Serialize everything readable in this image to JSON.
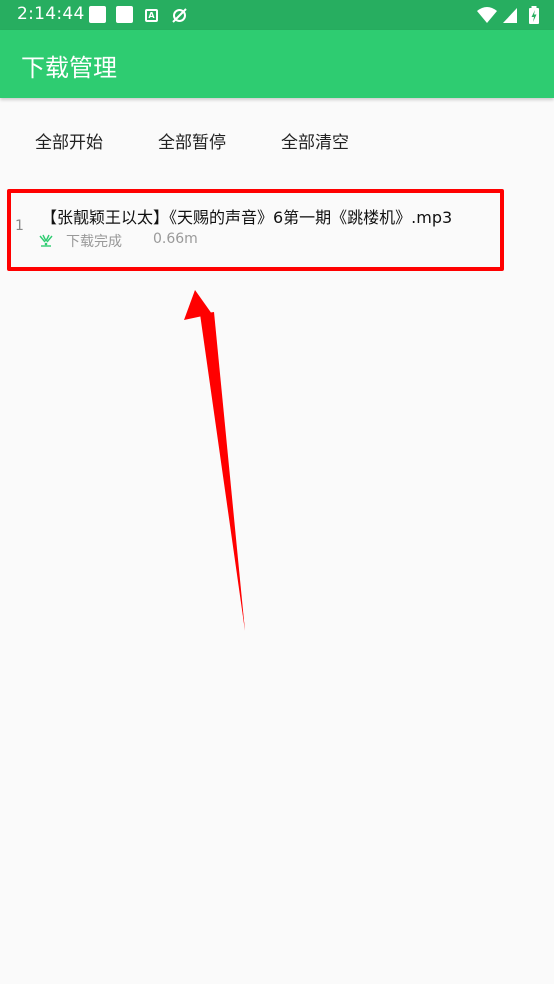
{
  "status_bar": {
    "time": "2:14:44",
    "notification_a_letter": "A",
    "icons": [
      "notification-square-icon",
      "notification-square-icon",
      "a-badge-icon",
      "sync-icon",
      "wifi-icon",
      "signal-icon",
      "battery-charging-icon"
    ]
  },
  "app_bar": {
    "title": "下载管理"
  },
  "actions": {
    "start_all": "全部开始",
    "pause_all": "全部暂停",
    "clear_all": "全部清空"
  },
  "downloads": [
    {
      "index": "1",
      "title": "【张靓颖王以太】《天赐的声音》6第一期《跳楼机》.mp3",
      "status": "下载完成",
      "size": "0.66m",
      "status_icon": "download-complete-icon"
    }
  ],
  "colors": {
    "status_bar": "#27ae60",
    "app_bar": "#2ecc71",
    "accent": "#2ecc71",
    "annotation": "#ff0000"
  }
}
